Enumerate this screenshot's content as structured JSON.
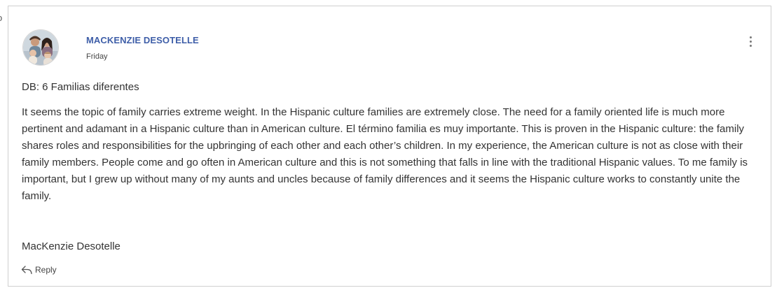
{
  "post": {
    "author": "MACKENZIE DESOTELLE",
    "date": "Friday",
    "title": "DB: 6 Familias diferentes",
    "body": "It seems the topic of family carries extreme weight. In the Hispanic culture families are extremely close. The need for a family oriented life is much more pertinent and adamant in a Hispanic culture than in American culture. El término familia es muy importante. This is proven in the Hispanic culture: the family shares roles and responsibilities for the upbringing of each other and each other’s children. In my experience, the American culture is not as close with their family members. People come and go often in American culture and this is not something that falls in line with the traditional Hispanic values. To me family is important, but I grew up without many of my aunts and uncles because of family differences and it seems the Hispanic culture works to constantly unite the family.",
    "signature": "MacKenzie Desotelle"
  },
  "actions": {
    "reply_label": "Reply",
    "more_icon": "more-vertical-icon",
    "reply_icon": "reply-arrow-icon"
  },
  "colors": {
    "author_name": "#3e5ea8",
    "text": "#333333",
    "border": "#cfcfcf"
  }
}
